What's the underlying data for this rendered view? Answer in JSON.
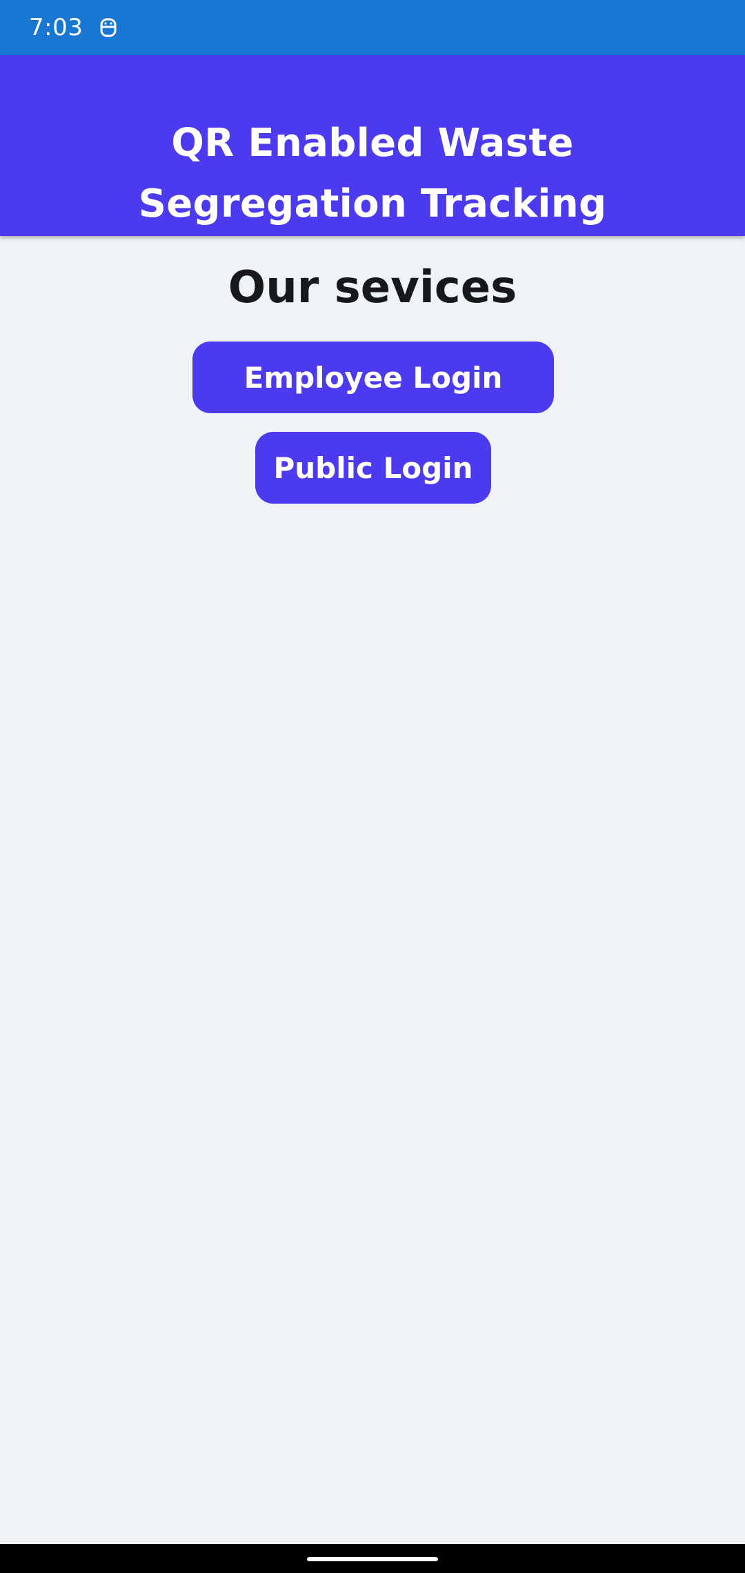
{
  "status_bar": {
    "time": "7:03",
    "icon": "accessibility-face-icon",
    "color": "#1976d2"
  },
  "header": {
    "title": "QR Enabled Waste Segregation Tracking",
    "color": "#4c3aee"
  },
  "main": {
    "heading": "Our sevices",
    "buttons": {
      "employee_login": "Employee Login",
      "public_login": "Public Login"
    },
    "button_color": "#4c3aee",
    "background": "#eff2f7"
  },
  "navigation": {
    "handle": "gesture-nav-handle"
  }
}
